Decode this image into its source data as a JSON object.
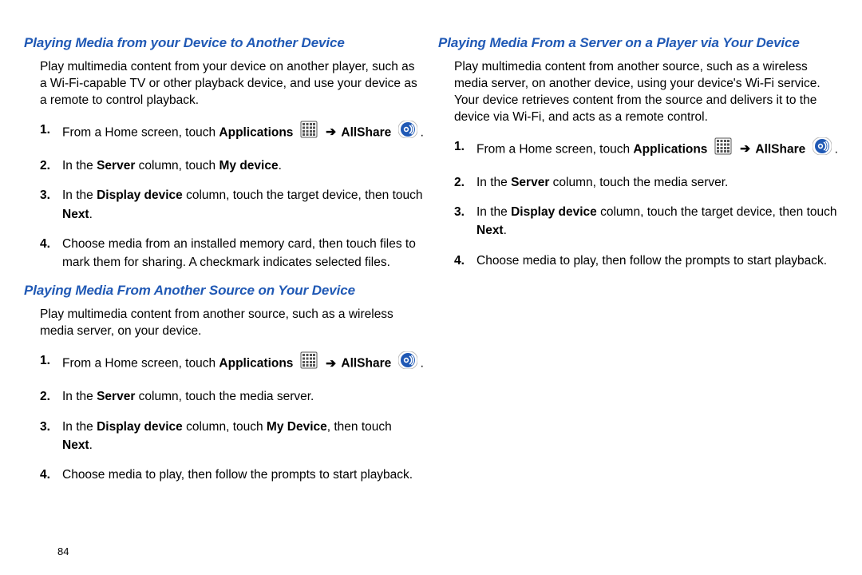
{
  "page_number": "84",
  "arrow": "➔",
  "icons": {
    "apps": "applications-grid-icon",
    "allshare": "allshare-icon"
  },
  "left": {
    "section1": {
      "heading": "Playing Media from your Device to Another Device",
      "intro": "Play multimedia content from your device on another player, such as  a Wi-Fi-capable TV or other playback device, and use your device as a remote to control playback.",
      "steps": {
        "s1": {
          "a": "From a Home screen, touch",
          "apps": "Applications",
          "allshare": "AllShare",
          "end": "."
        },
        "s2": {
          "a": "In the",
          "server": "Server",
          "b": "column, touch",
          "mydevice": "My device",
          "end": "."
        },
        "s3": {
          "a": "In the",
          "dd": "Display device",
          "b": "column, touch the target device, then touch",
          "next": "Next",
          "end": "."
        },
        "s4": "Choose media from an installed memory card, then touch files to mark them for sharing. A checkmark indicates selected files."
      }
    },
    "section2": {
      "heading": "Playing Media From Another Source on Your Device",
      "intro": "Play multimedia content from another source, such as a wireless media server, on your device.",
      "steps": {
        "s1": {
          "a": "From a Home screen, touch",
          "apps": "Applications",
          "allshare": "AllShare",
          "end": "."
        },
        "s2": {
          "a": "In the",
          "server": "Server",
          "b": "column, touch the media server."
        },
        "s3": {
          "a": "In the",
          "dd": "Display device",
          "b": "column, touch",
          "mydev": "My Device",
          "c": ", then touch",
          "next": "Next",
          "end": "."
        },
        "s4": "Choose media to play, then follow the prompts to start playback."
      }
    }
  },
  "right": {
    "section1": {
      "heading": "Playing Media From a Server on a Player via Your Device",
      "intro": "Play multimedia content from another source, such as a wireless media server, on another device, using your device's Wi-Fi service. Your device retrieves content from the source and delivers it to the device via Wi-Fi, and acts as a remote control.",
      "steps": {
        "s1": {
          "a": "From a Home screen, touch",
          "apps": "Applications",
          "allshare": "AllShare",
          "end": "."
        },
        "s2": {
          "a": "In the",
          "server": "Server",
          "b": "column, touch the media server."
        },
        "s3": {
          "a": "In the",
          "dd": "Display device",
          "b": "column, touch the target device, then touch",
          "next": "Next",
          "end": "."
        },
        "s4": "Choose media to play, then follow the prompts to start playback."
      }
    }
  }
}
